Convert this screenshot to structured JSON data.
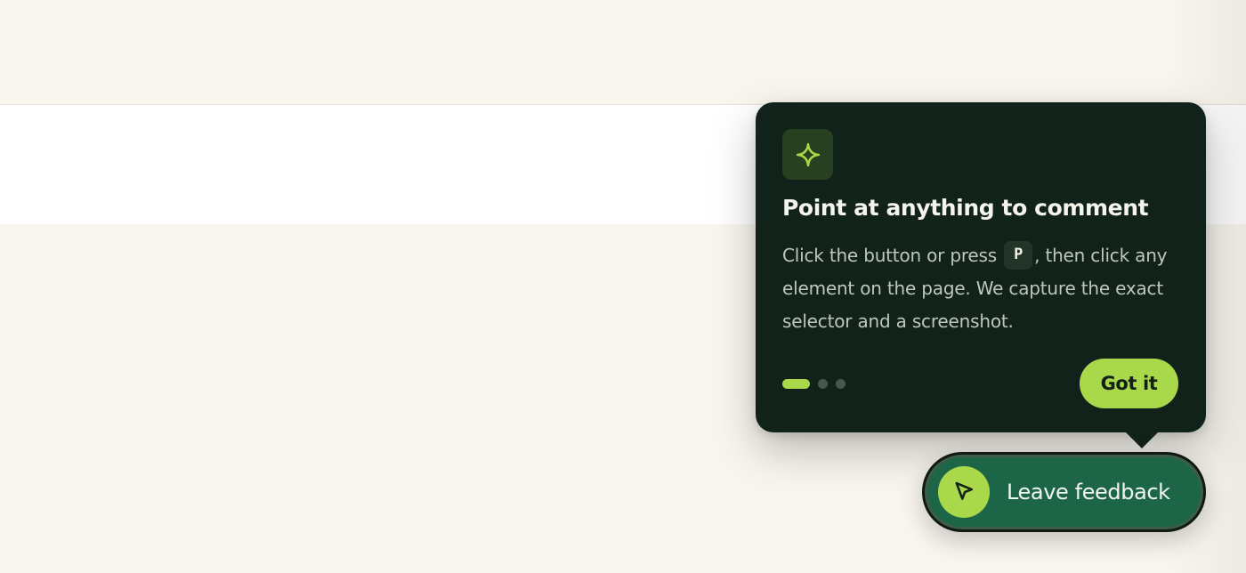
{
  "colors": {
    "page_background": "#f9f6ef",
    "card_background": "#10221a",
    "accent": "#a9d94b",
    "feedback_button": "#1c6647",
    "key_chip": "#233428"
  },
  "onboarding": {
    "icon": "sparkle-icon",
    "title": "Point at anything to comment",
    "body_before_key": "Click the button or press ",
    "key": "P",
    "body_after_key": ", then click any element on the page. We capture the exact selector and a screenshot.",
    "steps_total": 3,
    "step_current": 1,
    "confirm_label": "Got it"
  },
  "feedback_button": {
    "icon": "cursor-arrow-icon",
    "label": "Leave feedback"
  }
}
